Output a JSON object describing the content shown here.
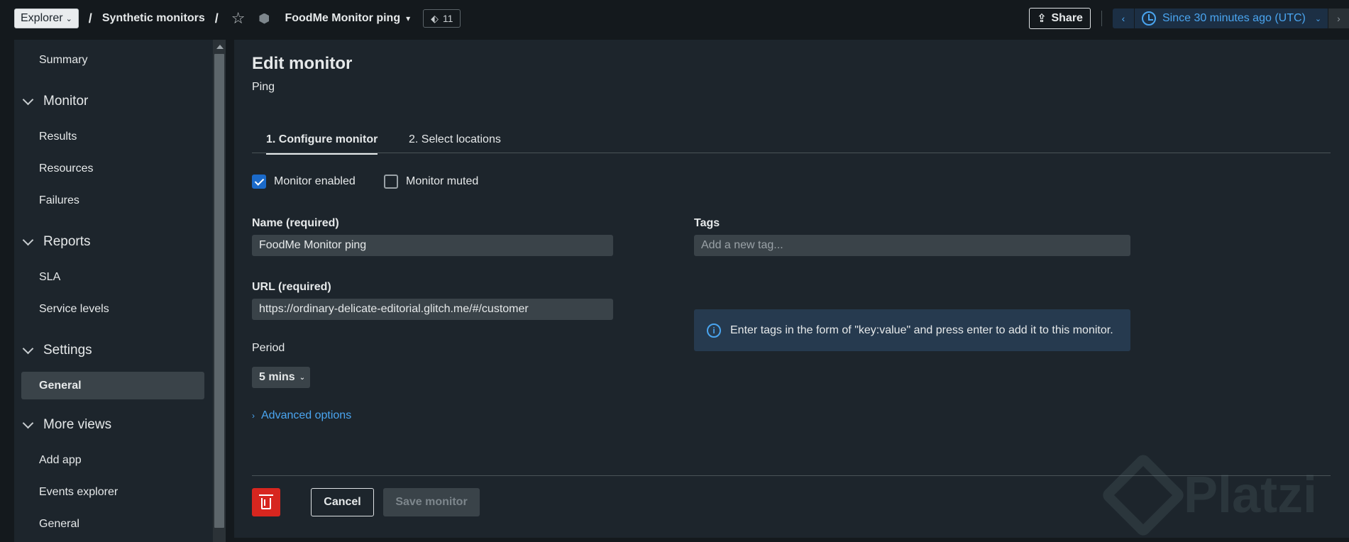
{
  "topbar": {
    "explorer_label": "Explorer",
    "breadcrumb_section": "Synthetic monitors",
    "entity_name": "FoodMe Monitor ping",
    "tag_count": "11",
    "share_label": "Share",
    "time_range": "Since 30 minutes ago (UTC)"
  },
  "sidebar": {
    "summary": "Summary",
    "sections": {
      "monitor": {
        "label": "Monitor",
        "items": [
          "Results",
          "Resources",
          "Failures"
        ]
      },
      "reports": {
        "label": "Reports",
        "items": [
          "SLA",
          "Service levels"
        ]
      },
      "settings": {
        "label": "Settings",
        "items": [
          "General"
        ]
      },
      "more_views": {
        "label": "More views",
        "items": [
          "Add app",
          "Events explorer",
          "General"
        ]
      }
    }
  },
  "main": {
    "title": "Edit monitor",
    "subtitle": "Ping",
    "tabs": [
      "1. Configure monitor",
      "2. Select locations"
    ],
    "monitor_enabled_label": "Monitor enabled",
    "monitor_enabled_checked": true,
    "monitor_muted_label": "Monitor muted",
    "monitor_muted_checked": false,
    "name_label": "Name (required)",
    "name_value": "FoodMe Monitor ping",
    "url_label": "URL (required)",
    "url_value": "https://ordinary-delicate-editorial.glitch.me/#/customer",
    "tags_label": "Tags",
    "tags_placeholder": "Add a new tag...",
    "info_text": "Enter tags in the form of \"key:value\" and press enter to add it to this monitor.",
    "period_label": "Period",
    "period_value": "5 mins",
    "advanced_options": "Advanced options",
    "cancel_label": "Cancel",
    "save_label": "Save monitor"
  },
  "watermark": "Platzi",
  "colors": {
    "accent": "#4aa5f0",
    "danger": "#d7261f",
    "checkbox": "#1b6ac9",
    "panel": "#1d252c",
    "background": "#14191d"
  }
}
